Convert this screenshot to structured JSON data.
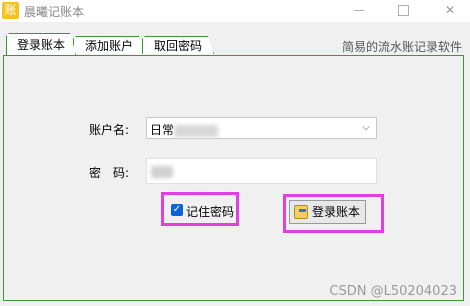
{
  "window": {
    "title": "晨曦记账本",
    "app_icon_glyph": "账",
    "minimize_icon": "minimize-icon",
    "maximize_icon": "maximize-icon",
    "close_glyph": "✕"
  },
  "tabs": [
    {
      "label": "登录账本",
      "active": true
    },
    {
      "label": "添加账户",
      "active": false
    },
    {
      "label": "取回密码",
      "active": false
    }
  ],
  "slogan": "简易的流水账记录软件",
  "form": {
    "account_label": "账户名:",
    "account_value": "日常",
    "password_label": "密　码:",
    "password_value": "",
    "dropdown_icon": "chevron-down-icon",
    "dropdown_glyph": "⌵"
  },
  "remember": {
    "label": "记住密码",
    "checked": true,
    "check_glyph": "✓"
  },
  "login_button": {
    "label": "登录账本",
    "icon": "key-icon"
  },
  "watermark": "CSDN @L50204023",
  "colors": {
    "tab_border": "#3a9a3a",
    "highlight": "#e040e0",
    "checkbox": "#0a64d8",
    "app_icon": "#f4c21b"
  }
}
